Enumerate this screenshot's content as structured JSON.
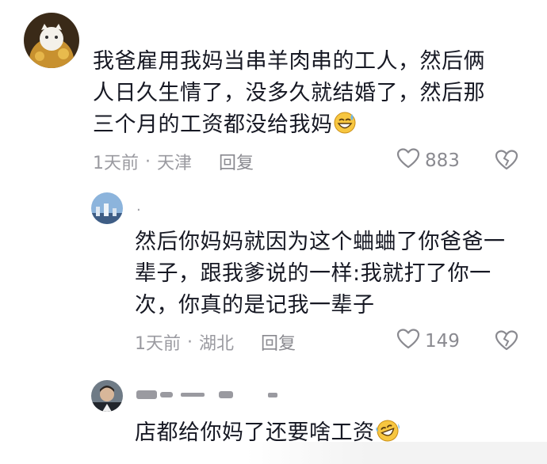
{
  "comments": [
    {
      "text_lines": [
        "我爸雇用我妈当串羊肉串的工人，然后俩",
        "人日久生情了，没多久就结婚了，然后那",
        "三个月的工资都没给我妈"
      ],
      "emoji": "sweat-smile-emoji",
      "time": "1天前",
      "location": "天津",
      "reply_label": "回复",
      "likes": "883"
    },
    {
      "username": "·",
      "text_lines": [
        "然后你妈妈就因为这个蛐蛐了你爸爸一",
        "辈子，跟我爹说的一样:我就打了你一",
        "次，你真的是记我一辈子"
      ],
      "time": "1天前",
      "location": "湖北",
      "reply_label": "回复",
      "likes": "149"
    },
    {
      "text_lines": [
        "店都给你妈了还要啥工资"
      ],
      "emoji": "rofl-emoji"
    }
  ],
  "separator": "·",
  "icons": {
    "like": "heart-outline-icon",
    "dislike": "broken-heart-icon"
  },
  "colors": {
    "text": "#161823",
    "meta": "#9a9aa0"
  }
}
